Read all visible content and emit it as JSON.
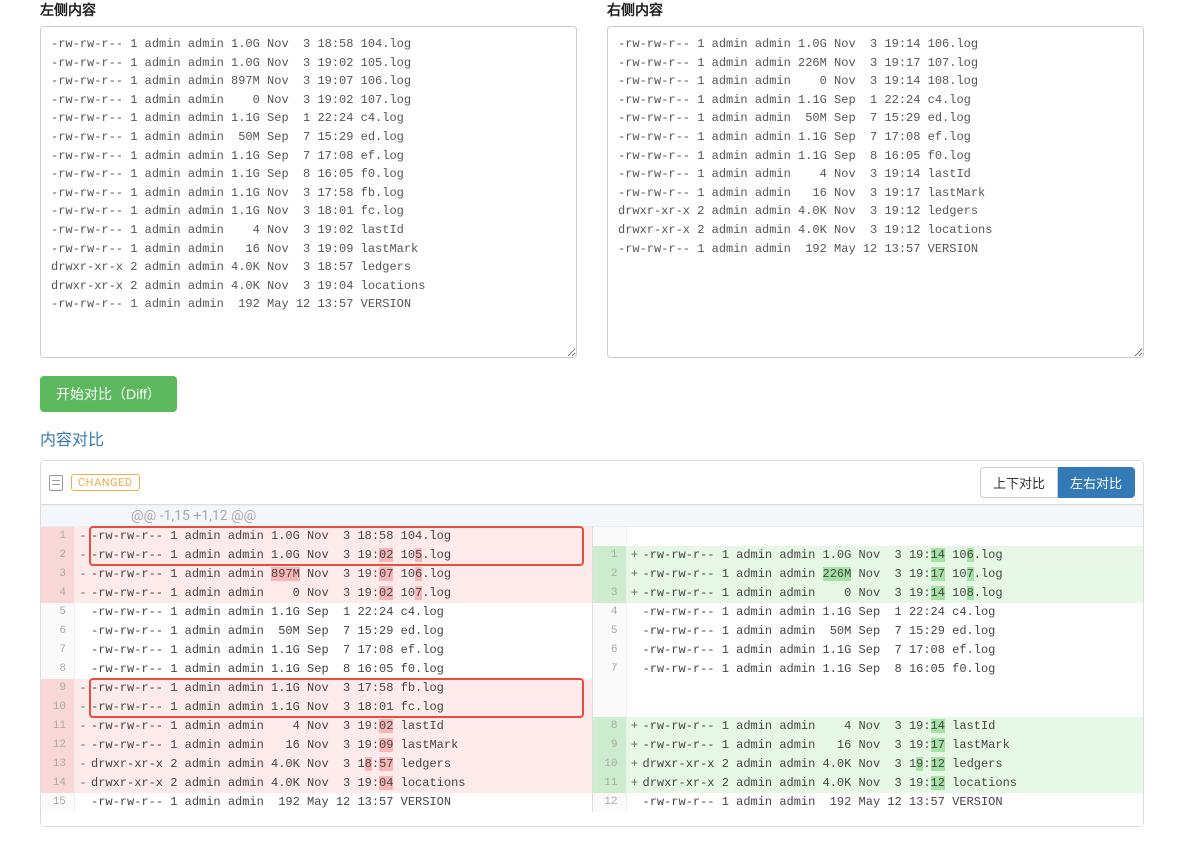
{
  "labels": {
    "left_panel": "左侧内容",
    "right_panel": "右侧内容",
    "diff_button": "开始对比（Diff）",
    "section_title": "内容对比",
    "changed_badge": "CHANGED",
    "view_updown": "上下对比",
    "view_leftright": "左右对比"
  },
  "left_text": "-rw-rw-r-- 1 admin admin 1.0G Nov  3 18:58 104.log\n-rw-rw-r-- 1 admin admin 1.0G Nov  3 19:02 105.log\n-rw-rw-r-- 1 admin admin 897M Nov  3 19:07 106.log\n-rw-rw-r-- 1 admin admin    0 Nov  3 19:02 107.log\n-rw-rw-r-- 1 admin admin 1.1G Sep  1 22:24 c4.log\n-rw-rw-r-- 1 admin admin  50M Sep  7 15:29 ed.log\n-rw-rw-r-- 1 admin admin 1.1G Sep  7 17:08 ef.log\n-rw-rw-r-- 1 admin admin 1.1G Sep  8 16:05 f0.log\n-rw-rw-r-- 1 admin admin 1.1G Nov  3 17:58 fb.log\n-rw-rw-r-- 1 admin admin 1.1G Nov  3 18:01 fc.log\n-rw-rw-r-- 1 admin admin    4 Nov  3 19:02 lastId\n-rw-rw-r-- 1 admin admin   16 Nov  3 19:09 lastMark\ndrwxr-xr-x 2 admin admin 4.0K Nov  3 18:57 ledgers\ndrwxr-xr-x 2 admin admin 4.0K Nov  3 19:04 locations\n-rw-rw-r-- 1 admin admin  192 May 12 13:57 VERSION",
  "right_text": "-rw-rw-r-- 1 admin admin 1.0G Nov  3 19:14 106.log\n-rw-rw-r-- 1 admin admin 226M Nov  3 19:17 107.log\n-rw-rw-r-- 1 admin admin    0 Nov  3 19:14 108.log\n-rw-rw-r-- 1 admin admin 1.1G Sep  1 22:24 c4.log\n-rw-rw-r-- 1 admin admin  50M Sep  7 15:29 ed.log\n-rw-rw-r-- 1 admin admin 1.1G Sep  7 17:08 ef.log\n-rw-rw-r-- 1 admin admin 1.1G Sep  8 16:05 f0.log\n-rw-rw-r-- 1 admin admin    4 Nov  3 19:14 lastId\n-rw-rw-r-- 1 admin admin   16 Nov  3 19:17 lastMark\ndrwxr-xr-x 2 admin admin 4.0K Nov  3 19:12 ledgers\ndrwxr-xr-x 2 admin admin 4.0K Nov  3 19:12 locations\n-rw-rw-r-- 1 admin admin  192 May 12 13:57 VERSION",
  "hunk_header": "@@ -1,15 +1,12 @@",
  "diff": {
    "left": [
      {
        "n": 1,
        "t": "del",
        "parts": [
          {
            "s": "-rw-rw-r-- 1 admin admin 1.0G Nov  3 18:58 104.log"
          }
        ]
      },
      {
        "n": 2,
        "t": "del",
        "parts": [
          {
            "s": "-rw-rw-r-- 1 admin admin 1.0G Nov  3 19:"
          },
          {
            "s": "02",
            "h": 1
          },
          {
            "s": " 10"
          },
          {
            "s": "5",
            "h": 1
          },
          {
            "s": ".log"
          }
        ]
      },
      {
        "n": 3,
        "t": "del",
        "parts": [
          {
            "s": "-rw-rw-r-- 1 admin admin "
          },
          {
            "s": "897M",
            "h": 1
          },
          {
            "s": " Nov  3 19:"
          },
          {
            "s": "07",
            "h": 1
          },
          {
            "s": " 10"
          },
          {
            "s": "6",
            "h": 1
          },
          {
            "s": ".log"
          }
        ]
      },
      {
        "n": 4,
        "t": "del",
        "parts": [
          {
            "s": "-rw-rw-r-- 1 admin admin    0 Nov  3 19:"
          },
          {
            "s": "02",
            "h": 1
          },
          {
            "s": " 10"
          },
          {
            "s": "7",
            "h": 1
          },
          {
            "s": ".log"
          }
        ]
      },
      {
        "n": 5,
        "t": "ctx",
        "parts": [
          {
            "s": "-rw-rw-r-- 1 admin admin 1.1G Sep  1 22:24 c4.log"
          }
        ]
      },
      {
        "n": 6,
        "t": "ctx",
        "parts": [
          {
            "s": "-rw-rw-r-- 1 admin admin  50M Sep  7 15:29 ed.log"
          }
        ]
      },
      {
        "n": 7,
        "t": "ctx",
        "parts": [
          {
            "s": "-rw-rw-r-- 1 admin admin 1.1G Sep  7 17:08 ef.log"
          }
        ]
      },
      {
        "n": 8,
        "t": "ctx",
        "parts": [
          {
            "s": "-rw-rw-r-- 1 admin admin 1.1G Sep  8 16:05 f0.log"
          }
        ]
      },
      {
        "n": 9,
        "t": "del",
        "parts": [
          {
            "s": "-rw-rw-r-- 1 admin admin 1.1G Nov  3 17:58 fb.log"
          }
        ]
      },
      {
        "n": 10,
        "t": "del",
        "parts": [
          {
            "s": "-rw-rw-r-- 1 admin admin 1.1G Nov  3 18:01 fc.log"
          }
        ]
      },
      {
        "n": 11,
        "t": "del",
        "parts": [
          {
            "s": "-rw-rw-r-- 1 admin admin    4 Nov  3 19:"
          },
          {
            "s": "02",
            "h": 1
          },
          {
            "s": " lastId"
          }
        ]
      },
      {
        "n": 12,
        "t": "del",
        "parts": [
          {
            "s": "-rw-rw-r-- 1 admin admin   16 Nov  3 19:"
          },
          {
            "s": "09",
            "h": 1
          },
          {
            "s": " lastMark"
          }
        ]
      },
      {
        "n": 13,
        "t": "del",
        "parts": [
          {
            "s": "drwxr-xr-x 2 admin admin 4.0K Nov  3 1"
          },
          {
            "s": "8",
            "h": 1
          },
          {
            "s": ":"
          },
          {
            "s": "57",
            "h": 1
          },
          {
            "s": " ledgers"
          }
        ]
      },
      {
        "n": 14,
        "t": "del",
        "parts": [
          {
            "s": "drwxr-xr-x 2 admin admin 4.0K Nov  3 19:"
          },
          {
            "s": "04",
            "h": 1
          },
          {
            "s": " locations"
          }
        ]
      },
      {
        "n": 15,
        "t": "ctx",
        "parts": [
          {
            "s": "-rw-rw-r-- 1 admin admin  192 May 12 13:57 VERSION"
          }
        ]
      }
    ],
    "right": [
      {
        "n": null,
        "t": "blank"
      },
      {
        "n": 1,
        "t": "add",
        "parts": [
          {
            "s": "-rw-rw-r-- 1 admin admin 1.0G Nov  3 19:"
          },
          {
            "s": "14",
            "h": 1
          },
          {
            "s": " 10"
          },
          {
            "s": "6",
            "h": 1
          },
          {
            "s": ".log"
          }
        ]
      },
      {
        "n": 2,
        "t": "add",
        "parts": [
          {
            "s": "-rw-rw-r-- 1 admin admin "
          },
          {
            "s": "226M",
            "h": 1
          },
          {
            "s": " Nov  3 19:"
          },
          {
            "s": "17",
            "h": 1
          },
          {
            "s": " 10"
          },
          {
            "s": "7",
            "h": 1
          },
          {
            "s": ".log"
          }
        ]
      },
      {
        "n": 3,
        "t": "add",
        "parts": [
          {
            "s": "-rw-rw-r-- 1 admin admin    0 Nov  3 19:"
          },
          {
            "s": "14",
            "h": 1
          },
          {
            "s": " 10"
          },
          {
            "s": "8",
            "h": 1
          },
          {
            "s": ".log"
          }
        ]
      },
      {
        "n": 4,
        "t": "ctx",
        "parts": [
          {
            "s": "-rw-rw-r-- 1 admin admin 1.1G Sep  1 22:24 c4.log"
          }
        ]
      },
      {
        "n": 5,
        "t": "ctx",
        "parts": [
          {
            "s": "-rw-rw-r-- 1 admin admin  50M Sep  7 15:29 ed.log"
          }
        ]
      },
      {
        "n": 6,
        "t": "ctx",
        "parts": [
          {
            "s": "-rw-rw-r-- 1 admin admin 1.1G Sep  7 17:08 ef.log"
          }
        ]
      },
      {
        "n": 7,
        "t": "ctx",
        "parts": [
          {
            "s": "-rw-rw-r-- 1 admin admin 1.1G Sep  8 16:05 f0.log"
          }
        ]
      },
      {
        "n": null,
        "t": "blank"
      },
      {
        "n": null,
        "t": "blank"
      },
      {
        "n": 8,
        "t": "add",
        "parts": [
          {
            "s": "-rw-rw-r-- 1 admin admin    4 Nov  3 19:"
          },
          {
            "s": "14",
            "h": 1
          },
          {
            "s": " lastId"
          }
        ]
      },
      {
        "n": 9,
        "t": "add",
        "parts": [
          {
            "s": "-rw-rw-r-- 1 admin admin   16 Nov  3 19:"
          },
          {
            "s": "17",
            "h": 1
          },
          {
            "s": " lastMark"
          }
        ]
      },
      {
        "n": 10,
        "t": "add",
        "parts": [
          {
            "s": "drwxr-xr-x 2 admin admin 4.0K Nov  3 1"
          },
          {
            "s": "9",
            "h": 1
          },
          {
            "s": ":"
          },
          {
            "s": "12",
            "h": 1
          },
          {
            "s": " ledgers"
          }
        ]
      },
      {
        "n": 11,
        "t": "add",
        "parts": [
          {
            "s": "drwxr-xr-x 2 admin admin 4.0K Nov  3 19:"
          },
          {
            "s": "12",
            "h": 1
          },
          {
            "s": " locations"
          }
        ]
      },
      {
        "n": 12,
        "t": "ctx",
        "parts": [
          {
            "s": "-rw-rw-r-- 1 admin admin  192 May 12 13:57 VERSION"
          }
        ]
      }
    ]
  }
}
